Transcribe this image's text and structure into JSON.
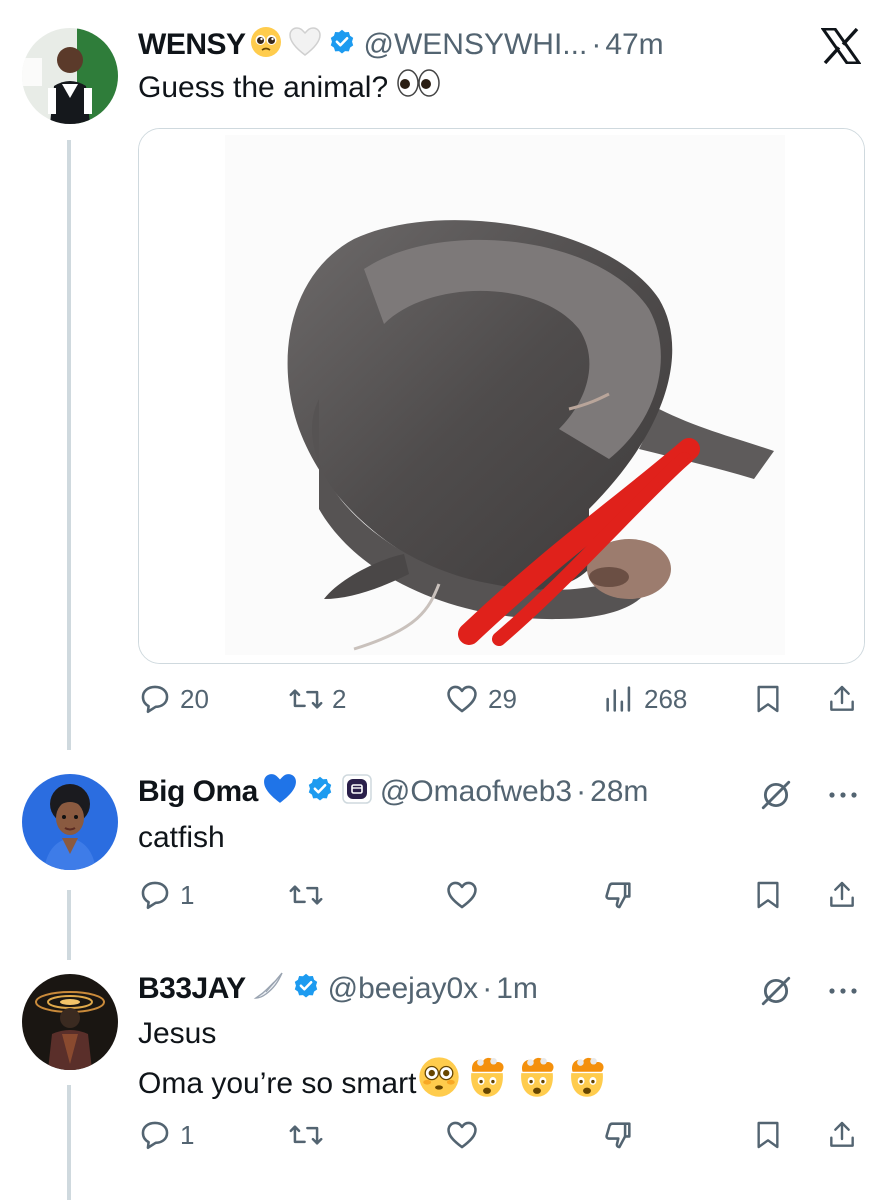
{
  "post": {
    "name": "WENSY",
    "handle": "@WENSYWHI...",
    "dot": "·",
    "time": "47m",
    "text": "Guess the animal?",
    "image_alt": "catfish with red scribble over its face",
    "stats": {
      "replies": "20",
      "reposts": "2",
      "likes": "29",
      "views": "268"
    }
  },
  "replies": [
    {
      "name": "Big Oma",
      "handle": "@Omaofweb3",
      "dot": "·",
      "time": "28m",
      "lines": [
        "catfish"
      ],
      "reply_count": "1"
    },
    {
      "name": "B33JAY",
      "handle": "@beejay0x",
      "dot": "·",
      "time": "1m",
      "lines": [
        "Jesus",
        "Oma you’re so smart"
      ],
      "reply_count": "1"
    }
  ],
  "icons": {
    "app_logo": "x-logo-icon",
    "verified": "verified-badge-icon",
    "reply": "reply-icon",
    "repost": "repost-icon",
    "like": "heart-icon",
    "views": "views-icon",
    "bookmark": "bookmark-icon",
    "share": "share-icon",
    "downvote": "downvote-icon",
    "grok": "grok-icon",
    "more": "more-icon"
  },
  "colors": {
    "verified_blue": "#1d9bf0",
    "secondary_text": "#536471",
    "thread_line": "#cfd9de"
  }
}
